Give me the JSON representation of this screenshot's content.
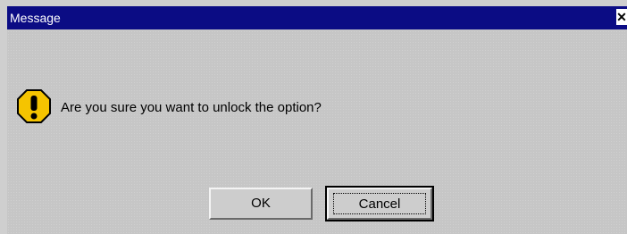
{
  "window": {
    "title": "Message",
    "close_glyph": "✕",
    "titlebar_color": "#0b0c84",
    "background_color": "#c6c6c6"
  },
  "icon": {
    "name": "warning-icon",
    "fill_color": "#f5c400"
  },
  "message": {
    "text": "Are you sure you want to unlock the option?"
  },
  "buttons": {
    "ok_label": "OK",
    "cancel_label": "Cancel"
  }
}
